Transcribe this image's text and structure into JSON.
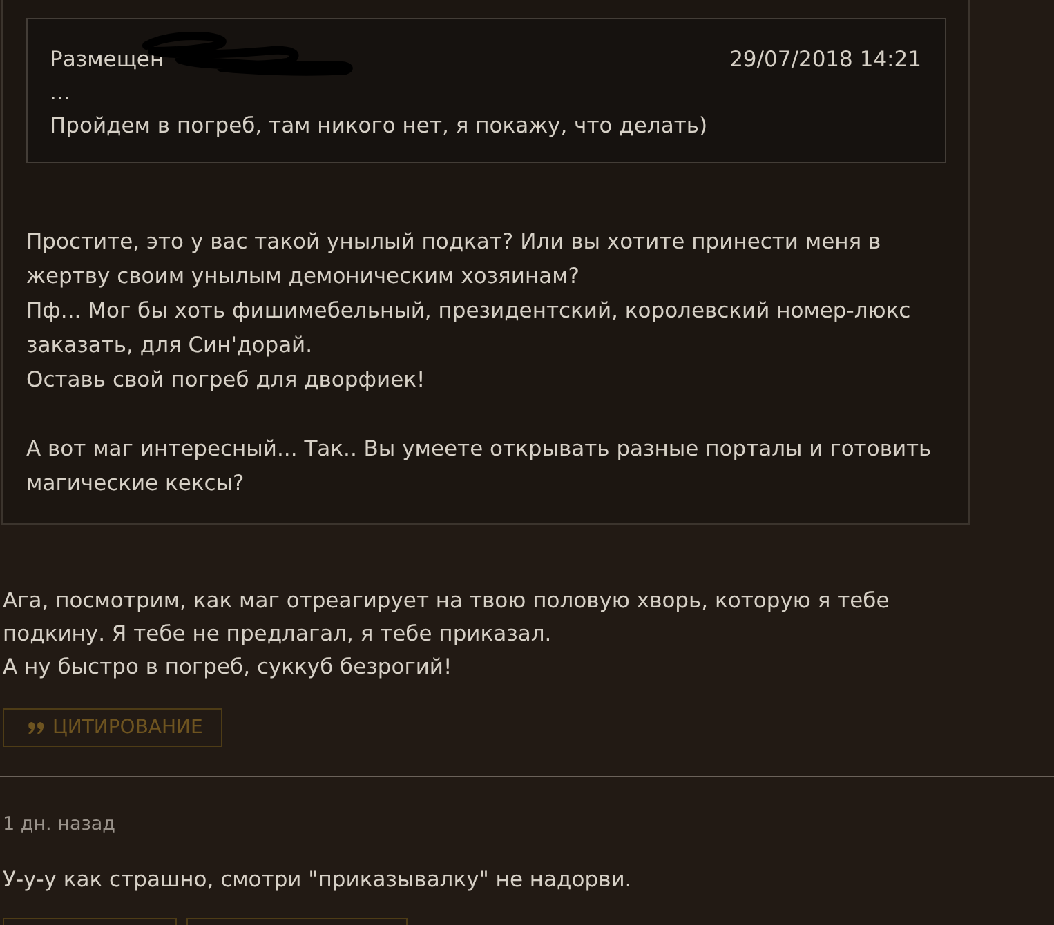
{
  "post": {
    "quote": {
      "nested_quote": {
        "author_label": "Размещен",
        "date": "29/07/2018 14:21",
        "lines": [
          "...",
          "Пройдем в погреб, там никого нет, я покажу, что делать)"
        ]
      },
      "paragraphs": [
        [
          "Простите, это у вас такой унылый подкат? Или вы хотите принести меня в жертву своим унылым демоническим хозяинам?",
          "Пф... Мог бы хоть фишимебельный, президентский, королевский номер-люкс заказать, для Син'дорай.",
          "Оставь свой погреб для дворфиек!"
        ],
        [
          "А вот маг интересный... Так.. Вы умеете открывать разные порталы и готовить магические кексы?"
        ]
      ]
    },
    "text_lines": [
      "Ага, посмотрим, как маг отреагирует на твою половую хворь, которую я тебе подкину. Я тебе не предлагал, я тебе приказал.",
      "А ну быстро в погреб, суккуб безрогий!"
    ],
    "quote_button": {
      "label": "ЦИТИРОВАНИЕ"
    }
  },
  "next_post": {
    "time": "1 дн. назад",
    "text": "У-у-у как страшно, смотри \"приказывалку\" не надорви."
  }
}
